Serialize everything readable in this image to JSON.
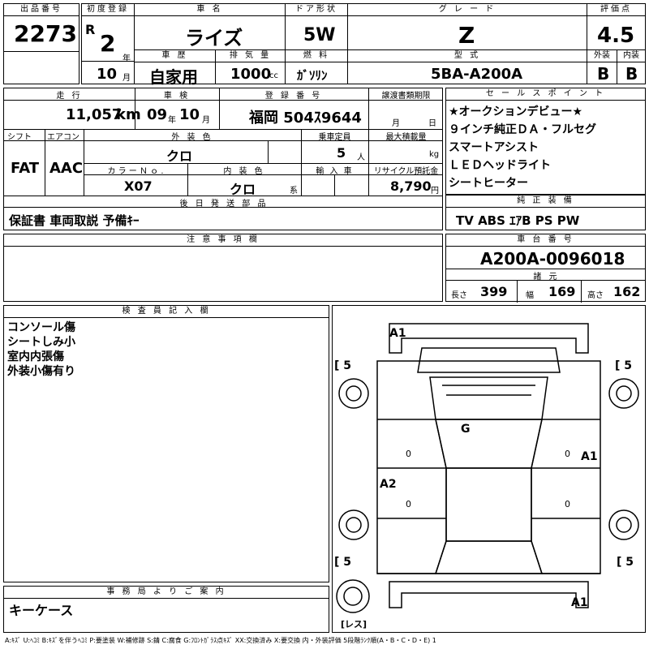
{
  "top": {
    "lot_label": "出品番号",
    "lot_value": "2273",
    "first_reg_label": "初度登録",
    "era_value": "R",
    "year_value": "2",
    "year_unit": "年",
    "month_value": "10",
    "month_unit": "月",
    "name_label": "車 名",
    "name_value": "ライズ",
    "door_label": "ドア形状",
    "door_value": "5W",
    "grade_label": "グ レ ー ド",
    "grade_value": "Z",
    "score_label": "評価点",
    "score_value": "4.5",
    "history_label": "車 歴",
    "history_value": "自家用",
    "cc_label": "排 気 量",
    "cc_value": "1000",
    "cc_unit": "cc",
    "fuel_label": "燃 料",
    "fuel_value": "ｶﾞｿﾘﾝ",
    "model_label": "型 式",
    "model_value": "5BA-A200A",
    "ext_label": "外装",
    "ext_value": "B",
    "int_label": "内装",
    "int_value": "B"
  },
  "row2": {
    "mileage_label": "走 行",
    "mileage_value": "11,057",
    "mileage_unit": "km",
    "inspect_label": "車 検",
    "inspect_year": "09",
    "inspect_year_unit": "年",
    "inspect_month": "10",
    "inspect_month_unit": "月",
    "plate_label": "登 録 番 号",
    "plate_value": "福岡 504ｽ9644",
    "transfer_label": "譲渡書類期限",
    "transfer_month_unit": "月",
    "transfer_day_unit": "日",
    "shift_label": "シフト",
    "shift_value": "FAT",
    "ac_label": "エアコン",
    "ac_value": "AAC",
    "exterior_label": "外 装 色",
    "exterior_value": "クロ",
    "capacity_label": "乗車定員",
    "capacity_value": "5",
    "capacity_unit": "人",
    "load_label": "最大積載量",
    "load_unit": "kg",
    "colorno_label": "カ ラ ー Ｎ ｏ .",
    "colorno_value": "X07",
    "interior_label": "内 装 色",
    "interior_value": "クロ",
    "interior_unit": "系",
    "import_label": "輸 入 車",
    "recycle_label": "リサイクル預託金",
    "recycle_value": "8,790",
    "recycle_unit": "円",
    "later_label": "後 日 発 送 部 品",
    "later_value": "保証書 車両取説 予備ｷｰ"
  },
  "sales": {
    "label": "セ ー ル ス ポ イ ン ト",
    "items": [
      "★オークションデビュー★",
      "９インチ純正ＤＡ・フルセグ",
      "スマートアシスト",
      "ＬＥＤヘッドライト",
      "シートヒーター"
    ]
  },
  "equip": {
    "label": "純 正 装 備",
    "value": "TV ABS ｴｱB PS PW"
  },
  "notes": {
    "label": "注 意 事 項 欄"
  },
  "chassis": {
    "label": "車 台 番 号",
    "value": "A200A-0096018",
    "dims_label": "諸 元",
    "length_label": "長さ",
    "length_value": "399",
    "width_label": "幅",
    "width_value": "169",
    "height_label": "高さ",
    "height_value": "162"
  },
  "inspector": {
    "label": "検 査 員 記 入 欄",
    "lines": [
      "コンソール傷",
      "シートしみ小",
      "室内内張傷",
      "外装小傷有り"
    ]
  },
  "office": {
    "label": "事 務 局 よ り ご 案 内",
    "value": "キーケース"
  },
  "diagram": {
    "tire_fl": "5",
    "tire_fr": "5",
    "tire_rl": "5",
    "tire_rr": "5",
    "mark_a1_top": "A1",
    "mark_g": "G",
    "mark_a1_right": "A1",
    "mark_a2": "A2",
    "mark_a1_bottom": "A1",
    "zero_1": "0",
    "zero_2": "0",
    "zero_3": "0",
    "zero_4": "0",
    "spare_label": "レス"
  },
  "legend": "A:ｷｽﾞ U:ﾍｺﾐ B:ｷｽﾞを伴うﾍｺﾐ P:要塗装 W:補修跡 S:錆 C:腐食 G:ﾌﾛﾝﾄｶﾞﾗｽ点ｷｽﾞ XX:交換済み X:要交換 内・外装評価 5段階ﾗﾝｸ順(A・B・C・D・E) 1"
}
